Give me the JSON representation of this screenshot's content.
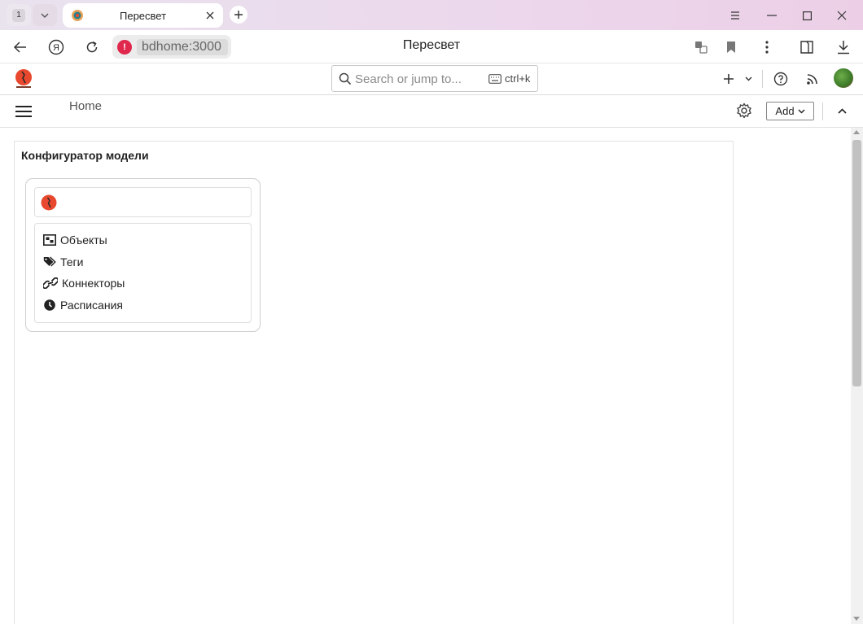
{
  "browser": {
    "tab_count": "1",
    "tab_title": "Пересвет",
    "url_host": "bdhome:3000",
    "page_title": "Пересвет",
    "icons": [
      "tab-list-chevron-icon",
      "tab-favicon-icon",
      "close-icon",
      "plus-icon",
      "menu-lines-icon",
      "minimize-icon",
      "maximize-icon",
      "window-close-icon",
      "back-arrow-icon",
      "yandex-icon",
      "reload-icon",
      "security-warning-icon",
      "translate-icon",
      "bookmark-icon",
      "more-vertical-icon",
      "collections-icon",
      "download-icon"
    ]
  },
  "header": {
    "search_placeholder": "Search or jump to...",
    "shortcut": "ctrl+k",
    "icons": [
      "app-logo-icon",
      "search-icon",
      "keyboard-icon",
      "plus-icon",
      "chevron-down-icon",
      "help-icon",
      "rss-icon",
      "avatar"
    ]
  },
  "subheader": {
    "breadcrumb": "Home",
    "add_label": "Add",
    "icons": [
      "hamburger-icon",
      "gear-icon",
      "chevron-down-icon",
      "chevron-up-icon"
    ]
  },
  "panel": {
    "title": "Конфигуратор модели",
    "menu": [
      {
        "label": "Объекты",
        "icon": "objects-icon"
      },
      {
        "label": "Теги",
        "icon": "tags-icon"
      },
      {
        "label": "Коннекторы",
        "icon": "link-icon"
      },
      {
        "label": "Расписания",
        "icon": "clock-icon"
      }
    ]
  },
  "colors": {
    "tabbar_gradient_start": "#e9e3ee",
    "tabbar_gradient_end": "#eccfe6",
    "warning_red": "#e0284d",
    "logo_orange": "#e8492e"
  }
}
